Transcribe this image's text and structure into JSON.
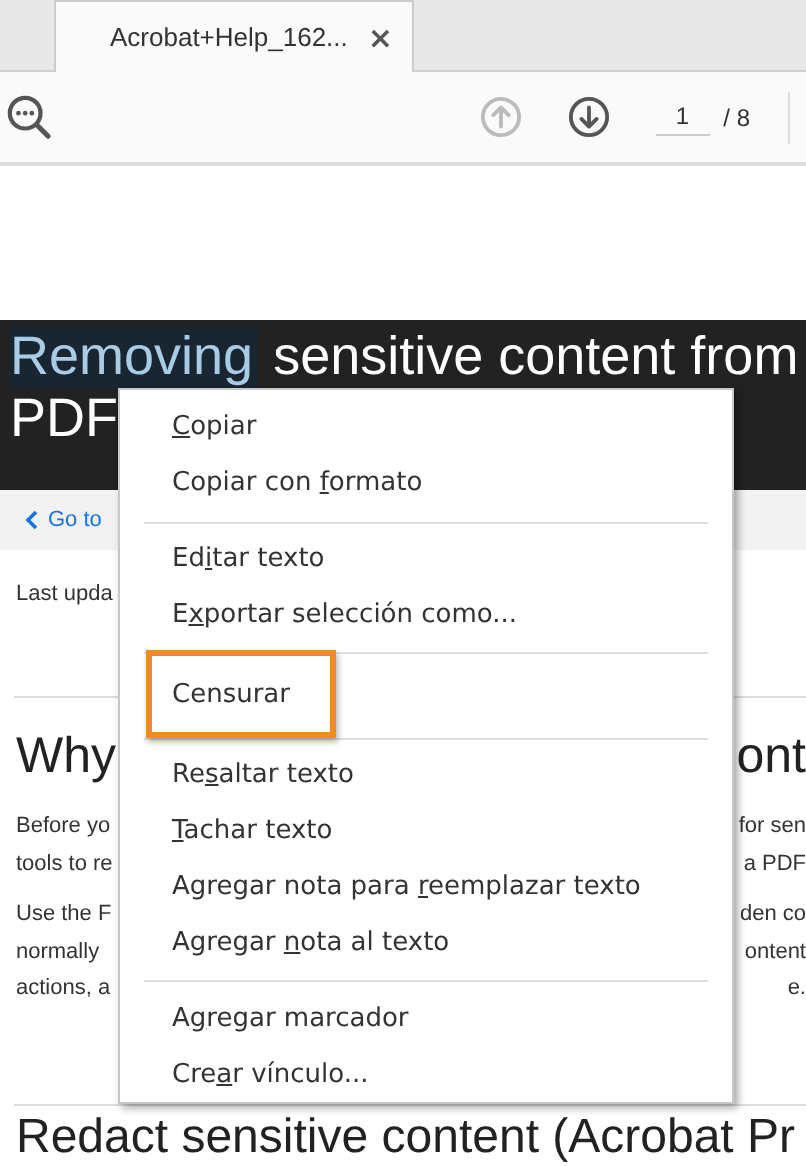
{
  "tabs": [
    {
      "title": "Acrobat+Help_162...",
      "close": "×",
      "selected": true
    }
  ],
  "toolbar": {
    "previous_page": {
      "disabled": true
    },
    "next_page": {
      "disabled": false
    },
    "page_number": "1",
    "page_total": "/ 8"
  },
  "document": {
    "title_line1": [
      {
        "text": "Removing",
        "selected": true
      },
      {
        "text": "sensitive content from",
        "selected": false
      }
    ],
    "title_line2": "PDF",
    "nav_link": "Go to",
    "last_updated": "Last upda",
    "section_heading": {
      "left": "Why",
      "right": "ont"
    },
    "paragraphs": [
      [
        {
          "left": "Before yo",
          "right": "for sen"
        },
        {
          "left": "tools to re",
          "right": "a PDF"
        }
      ],
      [
        {
          "left": "Use the F",
          "right": "den co"
        },
        {
          "left": "normally",
          "right": "ontent"
        },
        {
          "left": "actions, a",
          "right": "e."
        }
      ]
    ],
    "next_heading": "Redact sensitive content (Acrobat Pr"
  },
  "context_menu": [
    {
      "kind": "item",
      "key": "C",
      "after": "opiar",
      "highlighted": false
    },
    {
      "kind": "item",
      "before": "Copiar con ",
      "key": "f",
      "after": "ormato",
      "highlighted": false
    },
    {
      "kind": "separator"
    },
    {
      "kind": "item",
      "before": "Ed",
      "key": "i",
      "after": "tar texto",
      "highlighted": false
    },
    {
      "kind": "item",
      "before": "E",
      "key": "x",
      "after": "portar selección como...",
      "highlighted": false
    },
    {
      "kind": "separator"
    },
    {
      "kind": "item",
      "before": "Censurar",
      "highlighted": true
    },
    {
      "kind": "separator"
    },
    {
      "kind": "item",
      "before": "Re",
      "key": "s",
      "after": "altar texto",
      "highlighted": false
    },
    {
      "kind": "item",
      "key": "T",
      "after": "achar texto",
      "highlighted": false
    },
    {
      "kind": "item",
      "before": "Agregar nota para ",
      "key": "r",
      "after": "eemplazar texto",
      "highlighted": false
    },
    {
      "kind": "item",
      "before": "Agregar ",
      "key": "n",
      "after": "ota al texto",
      "highlighted": false
    },
    {
      "kind": "separator"
    },
    {
      "kind": "item",
      "before": "A",
      "key": "g",
      "after": "regar marcador",
      "highlighted": false
    },
    {
      "kind": "item",
      "before": "Cre",
      "key": "a",
      "after": "r vínculo...",
      "highlighted": false
    }
  ]
}
